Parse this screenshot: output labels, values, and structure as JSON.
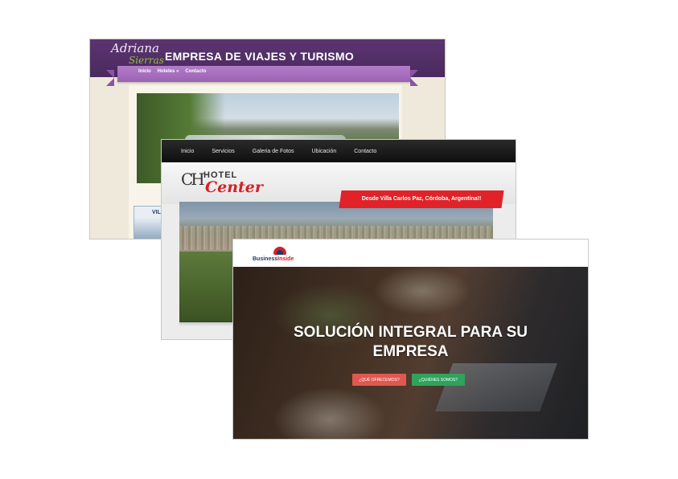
{
  "card_adriana": {
    "logo_line1": "Adriana",
    "logo_line2": "Sierras",
    "title": "EMPRESA DE VIAJES Y TURISMO",
    "nav": [
      "Inicio",
      "Hoteles »",
      "Contacto"
    ],
    "thumb_label": "VIL"
  },
  "card_hotel": {
    "nav": [
      "Inicio",
      "Servicios",
      "Galeria de Fotos",
      "Ubicación",
      "Contacto"
    ],
    "logo_mark": "CH",
    "logo_hotel": "HOTEL",
    "logo_center": "Center",
    "banner": "Desde Villa Carlos Paz, Córdoba, Argentina!!"
  },
  "card_business": {
    "logo_prefix": "Business",
    "logo_suffix": "Inside",
    "headline_line1": "SOLUCIÓN INTEGRAL PARA SU",
    "headline_line2": "EMPRESA",
    "button_primary": "¿QUÉ OFRECEMOS?",
    "button_secondary": "¿QUIÉNES SOMOS?"
  },
  "colors": {
    "adriana_header": "#5b3470",
    "adriana_ribbon": "#b37cc8",
    "hotel_nav": "#1a1a1a",
    "hotel_accent": "#e12229",
    "business_red": "#e0584f",
    "business_green": "#2fa35b"
  }
}
